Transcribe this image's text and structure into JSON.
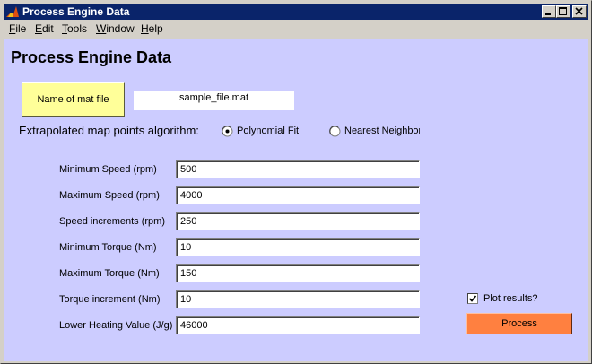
{
  "window": {
    "title": "Process Engine Data",
    "controls": [
      "minimize-icon",
      "maximize-icon",
      "close-icon"
    ]
  },
  "menu": [
    {
      "hotkey": "F",
      "rest": "ile"
    },
    {
      "hotkey": "E",
      "rest": "dit"
    },
    {
      "hotkey": "T",
      "rest": "ools"
    },
    {
      "hotkey": "W",
      "rest": "indow"
    },
    {
      "hotkey": "H",
      "rest": "elp"
    }
  ],
  "heading": "Process Engine Data",
  "mat_file": {
    "button_label": "Name of mat file",
    "value": "sample_file.mat"
  },
  "algorithm": {
    "label": "Extrapolated map points algorithm:",
    "options": [
      {
        "label": "Polynomial Fit",
        "selected": true
      },
      {
        "label": "Nearest Neighbor",
        "selected": false
      }
    ]
  },
  "fields": [
    {
      "label": "Minimum Speed (rpm)",
      "value": "500"
    },
    {
      "label": "Maximum Speed (rpm)",
      "value": "4000"
    },
    {
      "label": "Speed increments (rpm)",
      "value": "250"
    },
    {
      "label": "Minimum Torque (Nm)",
      "value": "10"
    },
    {
      "label": "Maximum Torque (Nm)",
      "value": "150"
    },
    {
      "label": "Torque increment (Nm)",
      "value": "10"
    },
    {
      "label": "Lower Heating Value (J/g)",
      "value": "46000"
    }
  ],
  "plot_results": {
    "label": "Plot results?",
    "checked": true
  },
  "process_button": "Process",
  "colors": {
    "titlebar": "#0a246a",
    "figure_background": "#ccccff",
    "mat_button": "#ffff99",
    "process_button": "#ff8040",
    "chrome": "#d4d0c8"
  }
}
